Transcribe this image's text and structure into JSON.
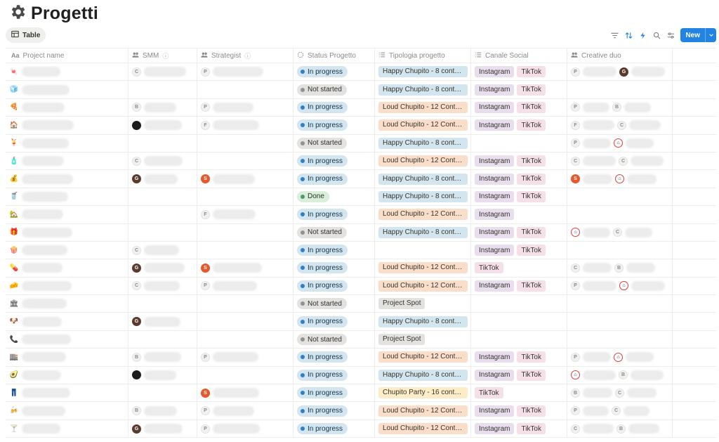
{
  "page": {
    "title": "Progetti",
    "title_icon": "gear-icon"
  },
  "view": {
    "tab_label": "Table",
    "tab_icon": "table-icon"
  },
  "toolbar": {
    "icons": [
      "filter-icon",
      "sort-icon",
      "automation-icon",
      "search-icon",
      "settings-icon"
    ],
    "new_label": "New"
  },
  "columns": [
    {
      "label": "Project name",
      "icon": "title-icon"
    },
    {
      "label": "SMM",
      "icon": "people-icon",
      "info": true
    },
    {
      "label": "Strategist",
      "icon": "people-icon",
      "info": true
    },
    {
      "label": "Status Progetto",
      "icon": "status-icon"
    },
    {
      "label": "Tipologia progetto",
      "icon": "list-icon"
    },
    {
      "label": "Canale Social",
      "icon": "list-icon"
    },
    {
      "label": "Creative duo",
      "icon": "people-icon"
    }
  ],
  "status_labels": {
    "prog": "In progress",
    "not": "Not started",
    "done": "Done"
  },
  "tipologia_labels": {
    "happy": "Happy Chupito - 8 contenuti",
    "loud": "Loud Chupito - 12 Contenuti",
    "party": "Chupito Party - 16 contenuti",
    "spot": "Project Spot"
  },
  "canale_labels": {
    "ig": "Instagram",
    "tt": "TikTok"
  },
  "rows": [
    {
      "emoji": "🍬",
      "smm": [
        "C"
      ],
      "strategist": [
        "P"
      ],
      "status": "prog",
      "tipo": "happy",
      "canali": [
        "ig",
        "tt"
      ],
      "duo": [
        "P",
        "G"
      ]
    },
    {
      "emoji": "🧊",
      "smm": [],
      "strategist": [],
      "status": "not",
      "tipo": "happy",
      "canali": [
        "ig",
        "tt"
      ],
      "duo": []
    },
    {
      "emoji": "🍕",
      "smm": [
        "B"
      ],
      "strategist": [
        "P"
      ],
      "status": "prog",
      "tipo": "loud",
      "canali": [
        "ig",
        "tt"
      ],
      "duo": [
        "P",
        "B"
      ]
    },
    {
      "emoji": "🏠",
      "smm": [
        "K"
      ],
      "strategist": [
        "F"
      ],
      "status": "prog",
      "tipo": "loud",
      "canali": [
        "ig",
        "tt"
      ],
      "duo": [
        "F",
        "C"
      ]
    },
    {
      "emoji": "🍹",
      "smm": [],
      "strategist": [],
      "status": "not",
      "tipo": "happy",
      "canali": [],
      "duo": [
        "P",
        "R"
      ]
    },
    {
      "emoji": "🧴",
      "smm": [
        "C"
      ],
      "strategist": [],
      "status": "prog",
      "tipo": "loud",
      "canali": [
        "ig",
        "tt"
      ],
      "duo": [
        "C",
        "C"
      ]
    },
    {
      "emoji": "💰",
      "smm": [
        "G"
      ],
      "strategist": [
        "S"
      ],
      "status": "prog",
      "tipo": "happy",
      "canali": [
        "ig",
        "tt"
      ],
      "duo": [
        "S",
        "R"
      ]
    },
    {
      "emoji": "🥤",
      "smm": [],
      "strategist": [],
      "status": "done",
      "tipo": "happy",
      "canali": [
        "ig",
        "tt"
      ],
      "duo": []
    },
    {
      "emoji": "🏡",
      "smm": [],
      "strategist": [
        "F"
      ],
      "status": "prog",
      "tipo": "loud",
      "canali": [
        "ig"
      ],
      "duo": []
    },
    {
      "emoji": "🎁",
      "smm": [],
      "strategist": [],
      "status": "not",
      "tipo": "happy",
      "canali": [
        "ig",
        "tt"
      ],
      "duo": [
        "R",
        "C"
      ]
    },
    {
      "emoji": "🍿",
      "smm": [
        "C"
      ],
      "strategist": [],
      "status": "prog",
      "tipo": "",
      "canali": [
        "ig",
        "tt"
      ],
      "duo": []
    },
    {
      "emoji": "💊",
      "smm": [
        "G"
      ],
      "strategist": [
        "S"
      ],
      "status": "prog",
      "tipo": "loud",
      "canali": [
        "tt"
      ],
      "duo": [
        "C",
        "B"
      ]
    },
    {
      "emoji": "🧀",
      "smm": [
        "C"
      ],
      "strategist": [
        "P"
      ],
      "status": "prog",
      "tipo": "loud",
      "canali": [
        "ig",
        "tt"
      ],
      "duo": [
        "P",
        "R"
      ]
    },
    {
      "emoji": "🏛",
      "smm": [],
      "strategist": [],
      "status": "not",
      "tipo": "spot",
      "canali": [],
      "duo": []
    },
    {
      "emoji": "🐶",
      "smm": [
        "G"
      ],
      "strategist": [],
      "status": "prog",
      "tipo": "happy",
      "canali": [],
      "duo": []
    },
    {
      "emoji": "📞",
      "smm": [],
      "strategist": [],
      "status": "not",
      "tipo": "spot",
      "canali": [],
      "duo": []
    },
    {
      "emoji": "🏬",
      "smm": [
        "B"
      ],
      "strategist": [
        "P"
      ],
      "status": "prog",
      "tipo": "loud",
      "canali": [
        "ig",
        "tt"
      ],
      "duo": [
        "P",
        "R"
      ]
    },
    {
      "emoji": "🥑",
      "smm": [
        "K"
      ],
      "strategist": [],
      "status": "prog",
      "tipo": "happy",
      "canali": [
        "ig",
        "tt"
      ],
      "duo": [
        "R",
        "B"
      ]
    },
    {
      "emoji": "👖",
      "smm": [],
      "strategist": [
        "S"
      ],
      "status": "prog",
      "tipo": "party",
      "canali": [
        "tt"
      ],
      "duo": [
        "B",
        "C"
      ]
    },
    {
      "emoji": "🍻",
      "smm": [
        "B"
      ],
      "strategist": [
        "P"
      ],
      "status": "prog",
      "tipo": "loud",
      "canali": [
        "ig",
        "tt"
      ],
      "duo": [
        "P",
        "C"
      ]
    },
    {
      "emoji": "🍸",
      "smm": [
        "G"
      ],
      "strategist": [
        "P"
      ],
      "status": "prog",
      "tipo": "loud",
      "canali": [
        "ig",
        "tt"
      ],
      "duo": [
        "C",
        "B"
      ]
    }
  ]
}
